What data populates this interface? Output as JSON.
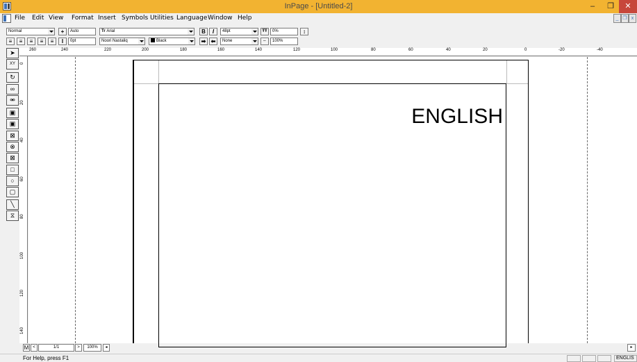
{
  "window": {
    "title": "InPage - [Untitled-2]",
    "min": "–",
    "max": "❐",
    "close": "✕"
  },
  "menu": [
    "File",
    "Edit",
    "View",
    "Format",
    "Insert",
    "Symbols",
    "Utilities",
    "Language",
    "Window",
    "Help"
  ],
  "toolbar1": {
    "style": "Normal",
    "spacing": "Auto",
    "font": "Arial",
    "bold": "B",
    "italic": "I",
    "size": "48pt",
    "percent": "0%"
  },
  "toolbar2": {
    "indent": "0pt",
    "urdu_font": "Noori Nastaliq",
    "color": "Black",
    "shade": "None",
    "scale": "100%"
  },
  "ruler_h_labels": [
    "260",
    "240",
    "220",
    "200",
    "180",
    "160",
    "140",
    "120",
    "100",
    "80",
    "60",
    "40",
    "20",
    "0",
    "-20",
    "-40"
  ],
  "ruler_v_labels": [
    "0",
    "20",
    "40",
    "60",
    "80",
    "100",
    "120",
    "140"
  ],
  "document": {
    "text": "ENGLISH"
  },
  "navigation": {
    "page": "M",
    "prev": "<",
    "page_count": "1/1",
    "next": ">",
    "zoom": "100%",
    "scroll_left": "◂",
    "scroll_right": "▸"
  },
  "status": {
    "help": "For Help, press F1",
    "language": "ENGLIS"
  }
}
